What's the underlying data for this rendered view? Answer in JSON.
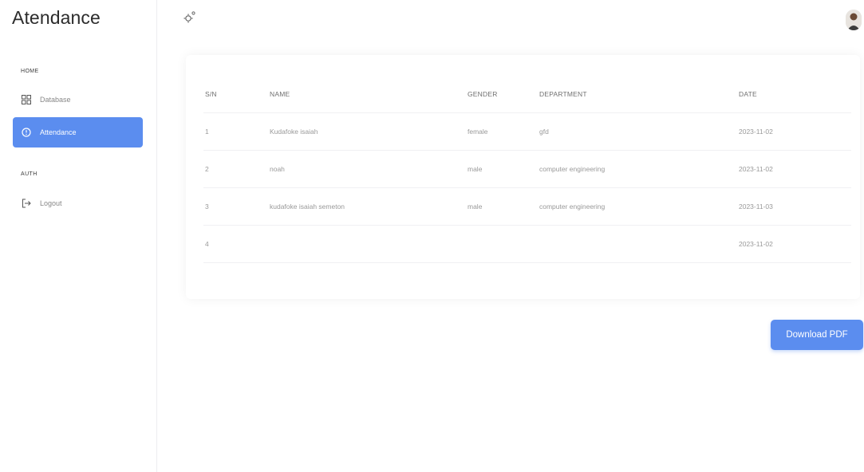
{
  "app": {
    "title": "Atendance"
  },
  "sidebar": {
    "sections": [
      {
        "label": "HOME"
      },
      {
        "label": "AUTH"
      }
    ],
    "items": [
      {
        "label": "Database",
        "icon": "dashboard-grid-icon",
        "active": false
      },
      {
        "label": "Attendance",
        "icon": "clock-icon",
        "active": true
      },
      {
        "label": "Logout",
        "icon": "logout-icon",
        "active": false
      }
    ]
  },
  "topbar": {
    "settings_icon": "gear-icon",
    "avatar_icon": "user-avatar"
  },
  "table": {
    "headers": [
      "S/N",
      "NAME",
      "GENDER",
      "DEPARTMENT",
      "DATE"
    ],
    "rows": [
      [
        "1",
        "Kudafoke isaiah",
        "female",
        "gfd",
        "2023-11-02"
      ],
      [
        "2",
        "noah",
        "male",
        "computer engineering",
        "2023-11-02"
      ],
      [
        "3",
        "kudafoke isaiah semeton",
        "male",
        "computer engineering",
        "2023-11-03"
      ],
      [
        "4",
        "",
        "",
        "",
        "2023-11-02"
      ]
    ]
  },
  "actions": {
    "download_label": "Download PDF"
  },
  "colors": {
    "accent": "#5b8def",
    "border": "#f0f0f3",
    "text_muted": "#999999"
  }
}
